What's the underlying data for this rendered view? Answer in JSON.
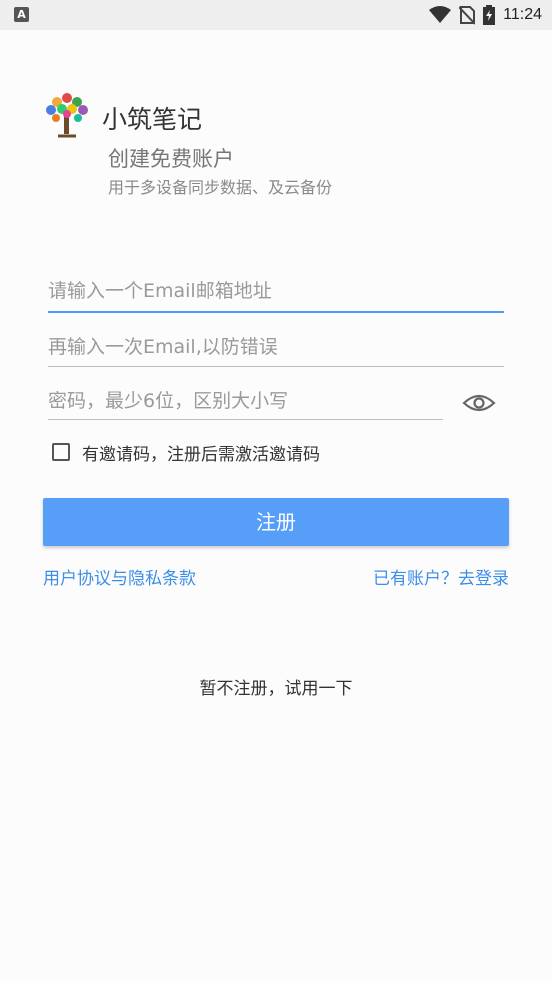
{
  "status_bar": {
    "notification_icon": "A",
    "time": "11:24",
    "icons": [
      "wifi-icon",
      "no-sim-icon",
      "battery-icon"
    ]
  },
  "header": {
    "logo_icon": "tree-logo-icon",
    "app_name": "小筑笔记",
    "subtitle": "创建免费账户",
    "description": "用于多设备同步数据、及云备份"
  },
  "form": {
    "email_placeholder": "请输入一个Email邮箱地址",
    "email_confirm_placeholder": "再输入一次Email,以防错误",
    "password_placeholder": "密码，最少6位，区别大小写",
    "invite_label": "有邀请码，注册后需激活邀请码",
    "register_button": "注册"
  },
  "links": {
    "terms": "用户协议与隐私条款",
    "login": "已有账户？去登录"
  },
  "trial_text": "暂不注册，试用一下",
  "colors": {
    "accent": "#569ef7",
    "link": "#3d8ee8",
    "background": "#fcfcfc"
  }
}
